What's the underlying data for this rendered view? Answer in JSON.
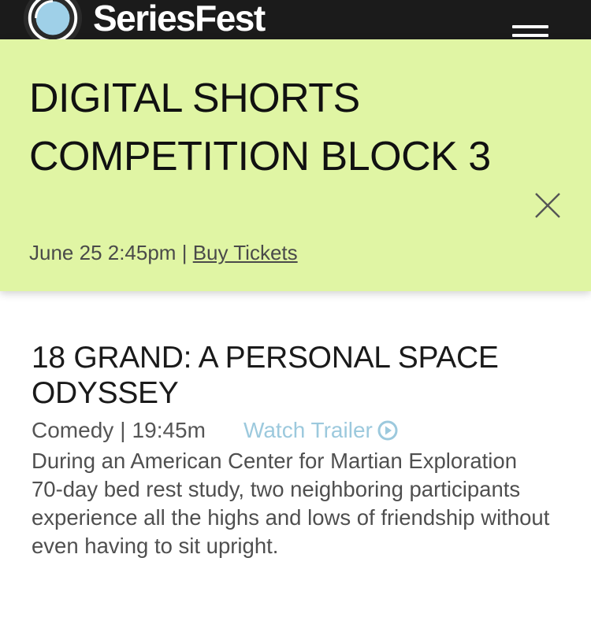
{
  "header": {
    "brand": "SeriesFest",
    "logo_icon": "seriesfest-logo-icon",
    "menu_icon": "hamburger-menu-icon",
    "background": "#1b1b1b"
  },
  "event": {
    "title": "DIGITAL SHORTS COMPETITION BLOCK 3",
    "datetime": "June 25 2:45pm",
    "separator": "|",
    "buy_label": "Buy Tickets",
    "close_icon": "close-icon",
    "background": "#e0f5a4"
  },
  "film": {
    "title": "18 GRAND: A PERSONAL SPACE ODYSSEY",
    "genre": "Comedy",
    "separator": "|",
    "duration": "19:45m",
    "trailer_label": "Watch Trailer",
    "trailer_icon": "play-circle-icon",
    "trailer_color": "#9cc9dd",
    "description": "During an American Center for Martian Exploration 70-day bed rest study, two neighboring participants experience all the highs and lows of friendship without even having to sit upright."
  }
}
